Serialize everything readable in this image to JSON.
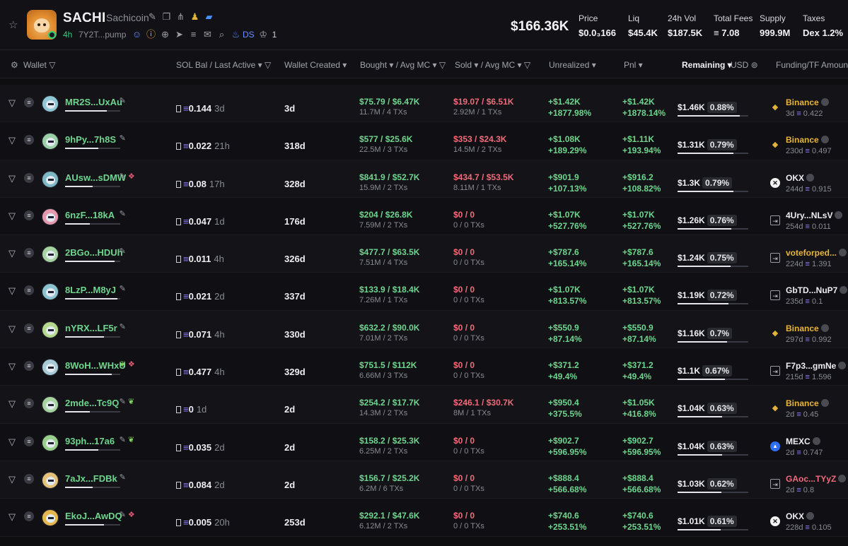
{
  "token": {
    "symbol": "SACHI",
    "name": "Sachicoin",
    "age": "4h",
    "address": "7Y2T...pump",
    "ds_label": "DS",
    "crown_count": "1",
    "market_cap": "$166.36K",
    "stats": [
      {
        "label": "Price",
        "value": "$0.0₃166"
      },
      {
        "label": "Liq",
        "value": "$45.4K"
      },
      {
        "label": "24h Vol",
        "value": "$187.5K"
      },
      {
        "label": "Total Fees",
        "value": "≡ 7.08"
      },
      {
        "label": "Supply",
        "value": "999.9M"
      },
      {
        "label": "Taxes",
        "value": "Dex 1.2%"
      }
    ]
  },
  "columns": {
    "wallet": "Wallet",
    "sol_bal": "SOL Bal",
    "last_active": "/ Last Active",
    "wallet_created": "Wallet Created",
    "bought": "Bought",
    "bought_avg": "/ Avg MC",
    "sold": "Sold",
    "sold_avg": "/ Avg MC",
    "unrealized": "Unrealized",
    "pnl": "Pnl",
    "remaining": "Remaining",
    "usd": "USD",
    "funding": "Funding/TF Amount"
  },
  "colors": {
    "green": "#6fd58e",
    "red": "#f16a7b",
    "accent": "#8f7bff",
    "binance": "#e2b33a"
  },
  "rows": [
    {
      "wallet": "MR2S...UxAu",
      "wallet_fill": 0.75,
      "tags": "pen",
      "sol": "0.144",
      "ago": "3d",
      "created": "3d",
      "bought": "$75.79",
      "bought_mc": "$6.47K",
      "bought_sub": "11.7M / 4 TXs",
      "sold": "$19.07",
      "sold_mc": "$6.51K",
      "sold_sub": "2.92M / 1 TXs",
      "sold_red": true,
      "unreal": "+$1.42K",
      "unreal_pct": "+1877.98%",
      "pnl": "+$1.42K",
      "pnl_pct": "+1878.14%",
      "rem": "$1.46K",
      "rem_pct": "0.88%",
      "rem_fill": 0.88,
      "f_type": "binance",
      "f_name": "Binance",
      "f_class": "cex",
      "f_age": "3d",
      "f_amt": "0.422"
    },
    {
      "wallet": "9hPy...7h8S",
      "wallet_fill": 0.6,
      "tags": "pen",
      "sol": "0.022",
      "ago": "21h",
      "created": "318d",
      "bought": "$577",
      "bought_mc": "$25.6K",
      "bought_sub": "22.5M / 3 TXs",
      "sold": "$353",
      "sold_mc": "$24.3K",
      "sold_sub": "14.5M / 2 TXs",
      "sold_red": true,
      "unreal": "+$1.08K",
      "unreal_pct": "+189.29%",
      "pnl": "+$1.11K",
      "pnl_pct": "+193.94%",
      "rem": "$1.31K",
      "rem_pct": "0.79%",
      "rem_fill": 0.79,
      "f_type": "binance",
      "f_name": "Binance",
      "f_class": "cex",
      "f_age": "230d",
      "f_amt": "0.497"
    },
    {
      "wallet": "AUsw...sDMW",
      "wallet_fill": 0.5,
      "tags": "pen-layer",
      "sol": "0.08",
      "ago": "17h",
      "created": "328d",
      "bought": "$841.9",
      "bought_mc": "$52.7K",
      "bought_sub": "15.9M / 2 TXs",
      "sold": "$434.7",
      "sold_mc": "$53.5K",
      "sold_sub": "8.11M / 1 TXs",
      "sold_red": true,
      "unreal": "+$901.9",
      "unreal_pct": "+107.13%",
      "pnl": "+$916.2",
      "pnl_pct": "+108.82%",
      "rem": "$1.3K",
      "rem_pct": "0.79%",
      "rem_fill": 0.79,
      "f_type": "okx",
      "f_name": "OKX",
      "f_class": "white",
      "f_age": "244d",
      "f_amt": "0.915"
    },
    {
      "wallet": "6nzF...18kA",
      "wallet_fill": 0.45,
      "tags": "pen",
      "sol": "0.047",
      "ago": "1d",
      "created": "176d",
      "bought": "$204",
      "bought_mc": "$26.8K",
      "bought_sub": "7.59M / 2 TXs",
      "sold": "$0",
      "sold_mc": "0",
      "sold_sub": "0 / 0 TXs",
      "sold_red": true,
      "unreal": "+$1.07K",
      "unreal_pct": "+527.76%",
      "pnl": "+$1.07K",
      "pnl_pct": "+527.76%",
      "rem": "$1.26K",
      "rem_pct": "0.76%",
      "rem_fill": 0.76,
      "f_type": "fund",
      "f_name": "4Ury...NLsV",
      "f_class": "white",
      "f_age": "254d",
      "f_amt": "0.011"
    },
    {
      "wallet": "2BGo...HDUh",
      "wallet_fill": 0.9,
      "tags": "pen",
      "sol": "0.011",
      "ago": "4h",
      "created": "326d",
      "bought": "$477.7",
      "bought_mc": "$63.5K",
      "bought_sub": "7.51M / 4 TXs",
      "sold": "$0",
      "sold_mc": "0",
      "sold_sub": "0 / 0 TXs",
      "sold_red": true,
      "unreal": "+$787.6",
      "unreal_pct": "+165.14%",
      "pnl": "+$787.6",
      "pnl_pct": "+165.14%",
      "rem": "$1.24K",
      "rem_pct": "0.75%",
      "rem_fill": 0.75,
      "f_type": "fund",
      "f_name": "voteforped...",
      "f_class": "cex",
      "f_age": "224d",
      "f_amt": "1.391"
    },
    {
      "wallet": "8LzP...M8yJ",
      "wallet_fill": 0.95,
      "tags": "pen",
      "sol": "0.021",
      "ago": "2d",
      "created": "337d",
      "bought": "$133.9",
      "bought_mc": "$18.4K",
      "bought_sub": "7.26M / 1 TXs",
      "sold": "$0",
      "sold_mc": "0",
      "sold_sub": "0 / 0 TXs",
      "sold_red": true,
      "unreal": "+$1.07K",
      "unreal_pct": "+813.57%",
      "pnl": "+$1.07K",
      "pnl_pct": "+813.57%",
      "rem": "$1.19K",
      "rem_pct": "0.72%",
      "rem_fill": 0.72,
      "f_type": "fund",
      "f_name": "GbTD...NuP7",
      "f_class": "white",
      "f_age": "235d",
      "f_amt": "0.1"
    },
    {
      "wallet": "nYRX...LF5r",
      "wallet_fill": 0.7,
      "tags": "pen",
      "sol": "0.071",
      "ago": "4h",
      "created": "330d",
      "bought": "$632.2",
      "bought_mc": "$90.0K",
      "bought_sub": "7.01M / 2 TXs",
      "sold": "$0",
      "sold_mc": "0",
      "sold_sub": "0 / 0 TXs",
      "sold_red": true,
      "unreal": "+$550.9",
      "unreal_pct": "+87.14%",
      "pnl": "+$550.9",
      "pnl_pct": "+87.14%",
      "rem": "$1.16K",
      "rem_pct": "0.7%",
      "rem_fill": 0.7,
      "f_type": "binance",
      "f_name": "Binance",
      "f_class": "cex",
      "f_age": "297d",
      "f_amt": "0.992"
    },
    {
      "wallet": "8WoH...WHxU",
      "wallet_fill": 0.85,
      "tags": "leaf-layer",
      "sol": "0.477",
      "ago": "4h",
      "created": "329d",
      "bought": "$751.5",
      "bought_mc": "$112K",
      "bought_sub": "6.66M / 3 TXs",
      "sold": "$0",
      "sold_mc": "0",
      "sold_sub": "0 / 0 TXs",
      "sold_red": true,
      "unreal": "+$371.2",
      "unreal_pct": "+49.4%",
      "pnl": "+$371.2",
      "pnl_pct": "+49.4%",
      "rem": "$1.1K",
      "rem_pct": "0.67%",
      "rem_fill": 0.67,
      "f_type": "fund",
      "f_name": "F7p3...gmNe",
      "f_class": "white",
      "f_age": "215d",
      "f_amt": "1.596"
    },
    {
      "wallet": "2mde...Tc9Q",
      "wallet_fill": 0.45,
      "tags": "pen-leaf",
      "sol": "0",
      "ago": "1d",
      "created": "2d",
      "bought": "$254.2",
      "bought_mc": "$17.7K",
      "bought_sub": "14.3M / 2 TXs",
      "sold": "$246.1",
      "sold_mc": "$30.7K",
      "sold_sub": "8M / 1 TXs",
      "sold_red": true,
      "unreal": "+$950.4",
      "unreal_pct": "+375.5%",
      "pnl": "+$1.05K",
      "pnl_pct": "+416.8%",
      "rem": "$1.04K",
      "rem_pct": "0.63%",
      "rem_fill": 0.63,
      "f_type": "binance",
      "f_name": "Binance",
      "f_class": "cex",
      "f_age": "2d",
      "f_amt": "0.45"
    },
    {
      "wallet": "93ph...17a6",
      "wallet_fill": 0.6,
      "tags": "pen-leaf",
      "sol": "0.035",
      "ago": "2d",
      "created": "2d",
      "bought": "$158.2",
      "bought_mc": "$25.3K",
      "bought_sub": "6.25M / 2 TXs",
      "sold": "$0",
      "sold_mc": "0",
      "sold_sub": "0 / 0 TXs",
      "sold_red": true,
      "unreal": "+$902.7",
      "unreal_pct": "+596.95%",
      "pnl": "+$902.7",
      "pnl_pct": "+596.95%",
      "rem": "$1.04K",
      "rem_pct": "0.63%",
      "rem_fill": 0.63,
      "f_type": "mexc",
      "f_name": "MEXC",
      "f_class": "white",
      "f_age": "2d",
      "f_amt": "0.747"
    },
    {
      "wallet": "7aJx...FDBk",
      "wallet_fill": 0.5,
      "tags": "pen",
      "sol": "0.084",
      "ago": "2d",
      "created": "2d",
      "bought": "$156.7",
      "bought_mc": "$25.2K",
      "bought_sub": "6.2M / 6 TXs",
      "sold": "$0",
      "sold_mc": "0",
      "sold_sub": "0 / 0 TXs",
      "sold_red": true,
      "unreal": "+$888.4",
      "unreal_pct": "+566.68%",
      "pnl": "+$888.4",
      "pnl_pct": "+566.68%",
      "rem": "$1.03K",
      "rem_pct": "0.62%",
      "rem_fill": 0.62,
      "f_type": "fund",
      "f_name": "GAoc...TYyZ",
      "f_class": "red",
      "f_age": "2d",
      "f_amt": "0.8"
    },
    {
      "wallet": "EkoJ...AwDQ",
      "wallet_fill": 0.7,
      "tags": "pen-layer",
      "sol": "0.005",
      "ago": "20h",
      "created": "253d",
      "bought": "$292.1",
      "bought_mc": "$47.6K",
      "bought_sub": "6.12M / 2 TXs",
      "sold": "$0",
      "sold_mc": "0",
      "sold_sub": "0 / 0 TXs",
      "sold_red": true,
      "unreal": "+$740.6",
      "unreal_pct": "+253.51%",
      "pnl": "+$740.6",
      "pnl_pct": "+253.51%",
      "rem": "$1.01K",
      "rem_pct": "0.61%",
      "rem_fill": 0.61,
      "f_type": "okx",
      "f_name": "OKX",
      "f_class": "white",
      "f_age": "228d",
      "f_amt": "0.105"
    }
  ]
}
